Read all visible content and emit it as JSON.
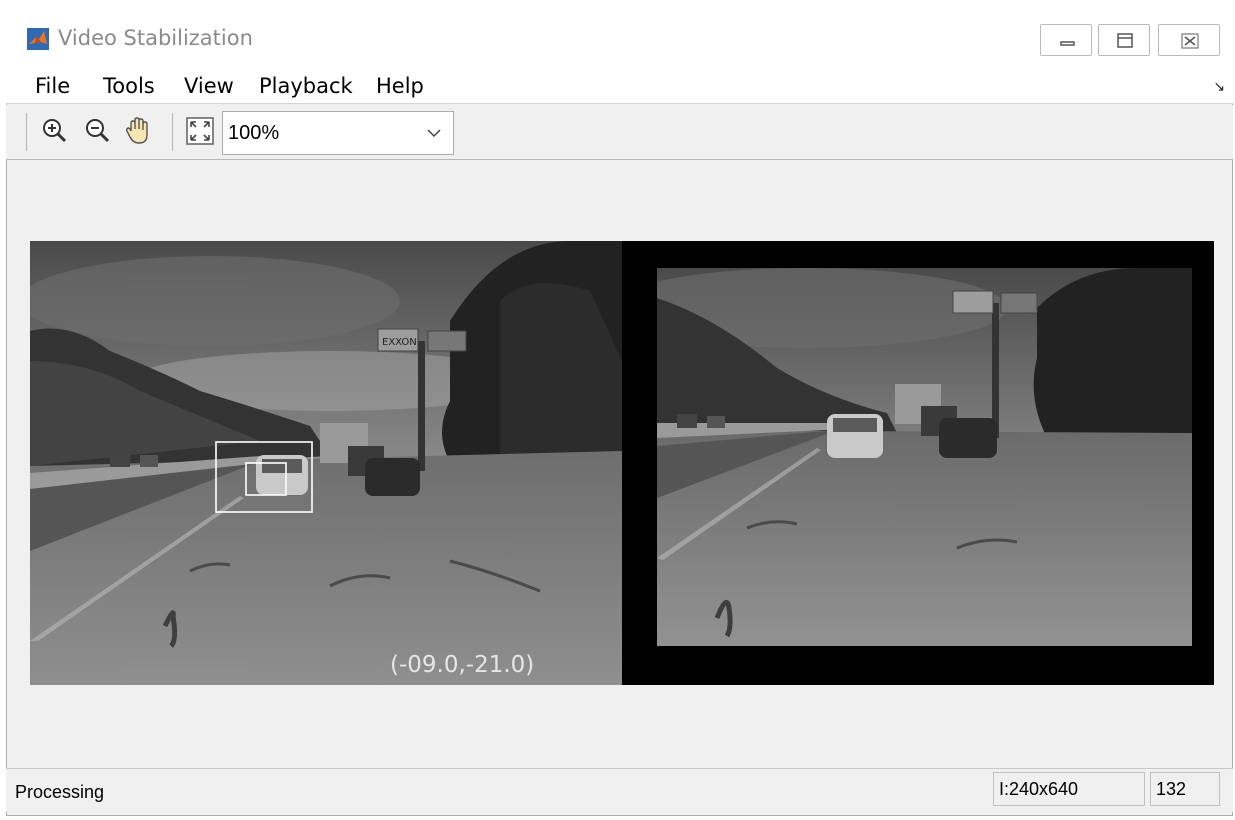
{
  "window": {
    "title": "Video Stabilization",
    "icon": "matlab-icon",
    "controls": [
      "minimize-icon",
      "maximize-icon",
      "close-icon"
    ]
  },
  "menu": {
    "items": [
      "File",
      "Tools",
      "View",
      "Playback",
      "Help"
    ],
    "collapse_arrow": "↘"
  },
  "toolbar": {
    "icons": [
      "zoom-in-icon",
      "zoom-out-icon",
      "pan-hand-icon",
      "fit-to-window-icon"
    ],
    "zoom_level": "100%"
  },
  "video": {
    "coordinate_readout": "(-09.0,-21.0)",
    "billboard_text": "EXXON"
  },
  "status": {
    "text": "Processing",
    "image_info": "I:240x640",
    "frame_number": "132"
  }
}
